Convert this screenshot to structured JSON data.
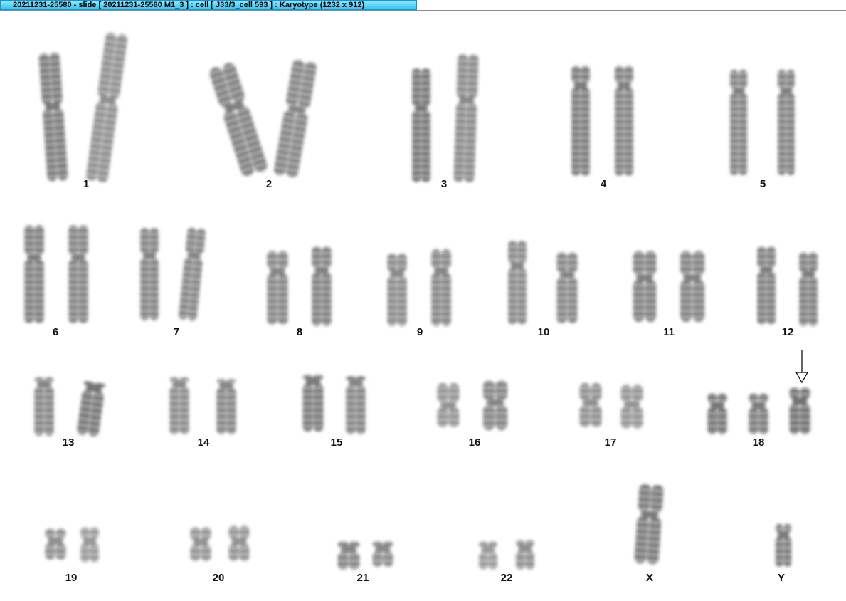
{
  "window": {
    "title": "20211231-25580 - slide [ 20211231-25580 M1_3 ] : cell [ J33/3_cell 593 ] : Karyotype  (1232 x 912)"
  },
  "karyotype": {
    "pairs": [
      {
        "label": "1"
      },
      {
        "label": "2"
      },
      {
        "label": "3"
      },
      {
        "label": "4"
      },
      {
        "label": "5"
      },
      {
        "label": "6"
      },
      {
        "label": "7"
      },
      {
        "label": "8"
      },
      {
        "label": "9"
      },
      {
        "label": "10"
      },
      {
        "label": "11"
      },
      {
        "label": "12"
      },
      {
        "label": "13"
      },
      {
        "label": "14"
      },
      {
        "label": "15"
      },
      {
        "label": "16"
      },
      {
        "label": "17"
      },
      {
        "label": "18"
      },
      {
        "label": "19"
      },
      {
        "label": "20"
      },
      {
        "label": "21"
      },
      {
        "label": "22"
      },
      {
        "label": "X"
      },
      {
        "label": "Y"
      }
    ],
    "marker": {
      "icon": "down-arrow-icon",
      "pair": "18"
    }
  }
}
